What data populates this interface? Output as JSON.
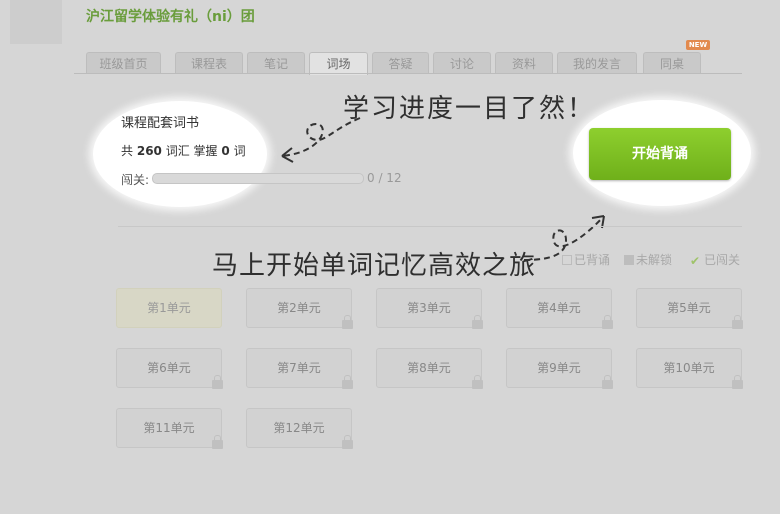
{
  "header": {
    "title": "沪江留学体验有礼（ni）团"
  },
  "tabs": [
    {
      "label": "班级首页"
    },
    {
      "label": "课程表"
    },
    {
      "label": "笔记"
    },
    {
      "label": "词场"
    },
    {
      "label": "答疑"
    },
    {
      "label": "讨论"
    },
    {
      "label": "资料"
    },
    {
      "label": "我的发言"
    },
    {
      "label": "同桌"
    }
  ],
  "new_badge": "NEW",
  "course": {
    "title": "课程配套词书",
    "stats_prefix": "共",
    "word_count": "260",
    "words_label": "词汇 掌握",
    "mastered_count": "0",
    "mastered_unit": "词",
    "level_label": "闯关:",
    "progress_text": "0 / 12",
    "progress_fraction": 0
  },
  "start_button": "开始背诵",
  "annotations": {
    "top": "学习进度一目了然！",
    "bottom": "马上开始单词记忆高效之旅"
  },
  "legend": {
    "recited": "已背诵",
    "locked": "未解锁",
    "passed": "已闯关"
  },
  "units": [
    "第1单元",
    "第2单元",
    "第3单元",
    "第4单元",
    "第5单元",
    "第6单元",
    "第7单元",
    "第8单元",
    "第9单元",
    "第10单元",
    "第11单元",
    "第12单元"
  ],
  "colors": {
    "accent": "#7cbf23",
    "title": "#6a9d3c"
  }
}
